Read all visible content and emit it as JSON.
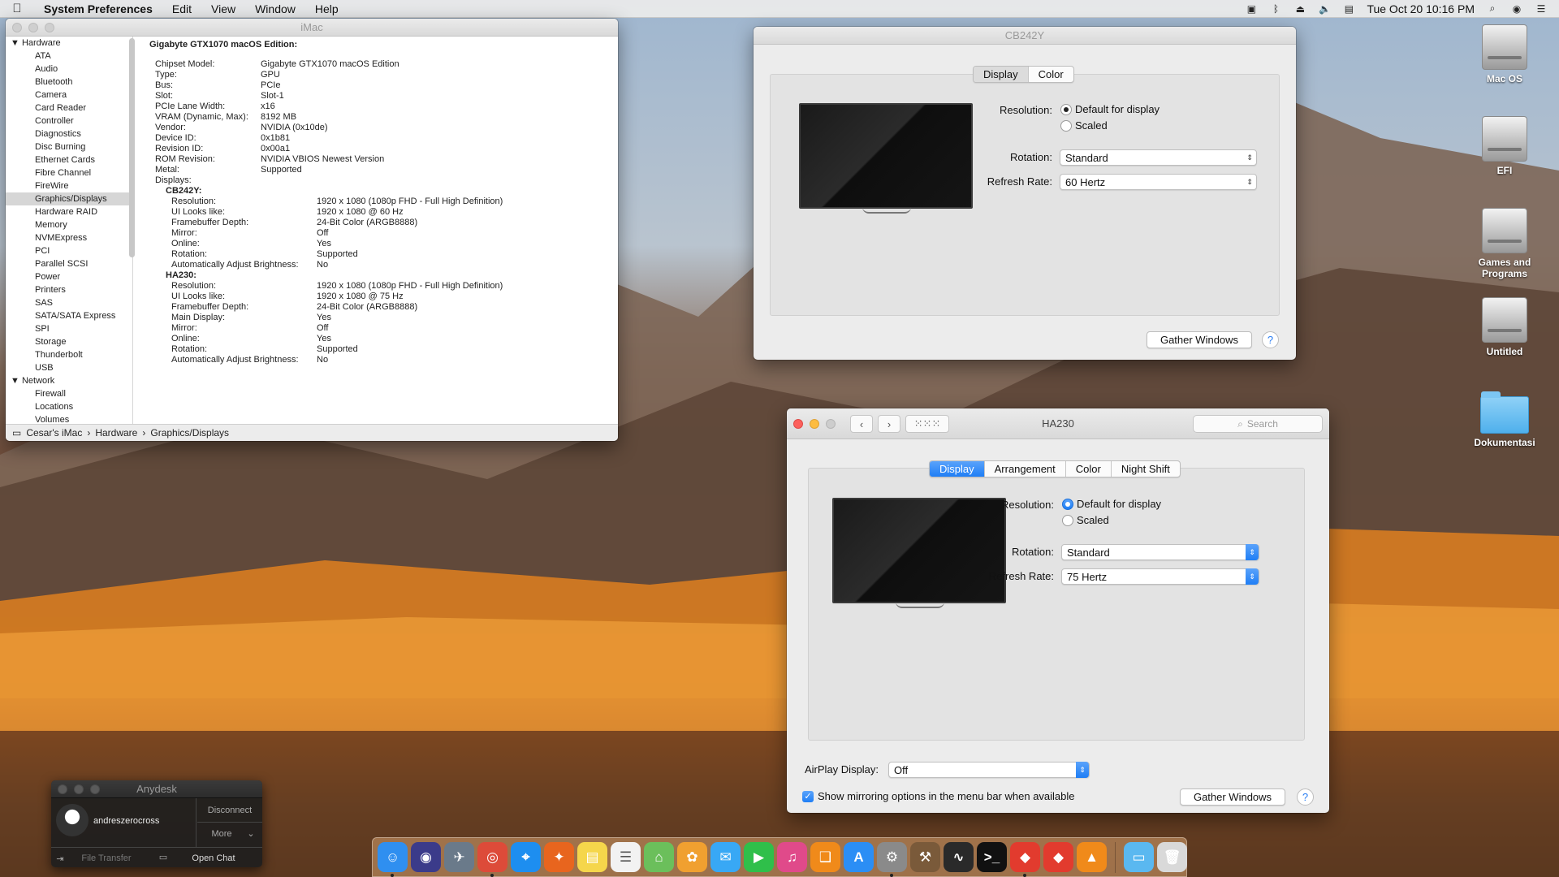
{
  "menubar": {
    "apple_icon": "apple-icon",
    "app_name": "System Preferences",
    "menus": [
      "Edit",
      "View",
      "Window",
      "Help"
    ],
    "status_icons": [
      "activity-icon",
      "bluetooth-icon",
      "airplay-icon",
      "volume-icon",
      "us-flag-icon"
    ],
    "datetime": "Tue Oct 20  10:16 PM",
    "right_icons": [
      "search-icon",
      "siri-icon",
      "list-icon"
    ]
  },
  "sysinfo": {
    "title": "iMac",
    "sidebar": {
      "hardware_label": "Hardware",
      "hardware_items": [
        "ATA",
        "Audio",
        "Bluetooth",
        "Camera",
        "Card Reader",
        "Controller",
        "Diagnostics",
        "Disc Burning",
        "Ethernet Cards",
        "Fibre Channel",
        "FireWire",
        "Graphics/Displays",
        "Hardware RAID",
        "Memory",
        "NVMExpress",
        "PCI",
        "Parallel SCSI",
        "Power",
        "Printers",
        "SAS",
        "SATA/SATA Express",
        "SPI",
        "Storage",
        "Thunderbolt",
        "USB"
      ],
      "selected": "Graphics/Displays",
      "network_label": "Network",
      "network_items": [
        "Firewall",
        "Locations",
        "Volumes"
      ]
    },
    "heading": "Gigabyte GTX1070 macOS Edition:",
    "properties": [
      {
        "k": "Chipset Model:",
        "v": "Gigabyte GTX1070 macOS Edition"
      },
      {
        "k": "Type:",
        "v": "GPU"
      },
      {
        "k": "Bus:",
        "v": "PCIe"
      },
      {
        "k": "Slot:",
        "v": "Slot-1"
      },
      {
        "k": "PCIe Lane Width:",
        "v": "x16"
      },
      {
        "k": "VRAM (Dynamic, Max):",
        "v": "8192 MB"
      },
      {
        "k": "Vendor:",
        "v": "NVIDIA (0x10de)"
      },
      {
        "k": "Device ID:",
        "v": "0x1b81"
      },
      {
        "k": "Revision ID:",
        "v": "0x00a1"
      },
      {
        "k": "ROM Revision:",
        "v": "NVIDIA VBIOS Newest Version"
      },
      {
        "k": "Metal:",
        "v": "Supported"
      },
      {
        "k": "Displays:",
        "v": ""
      }
    ],
    "displays": [
      {
        "name": "CB242Y:",
        "props": [
          {
            "k": "Resolution:",
            "v": "1920 x 1080 (1080p FHD - Full High Definition)"
          },
          {
            "k": "UI Looks like:",
            "v": "1920 x 1080 @ 60 Hz"
          },
          {
            "k": "Framebuffer Depth:",
            "v": "24-Bit Color (ARGB8888)"
          },
          {
            "k": "Mirror:",
            "v": "Off"
          },
          {
            "k": "Online:",
            "v": "Yes"
          },
          {
            "k": "Rotation:",
            "v": "Supported"
          },
          {
            "k": "Automatically Adjust Brightness:",
            "v": "No"
          }
        ]
      },
      {
        "name": "HA230:",
        "props": [
          {
            "k": "Resolution:",
            "v": "1920 x 1080 (1080p FHD - Full High Definition)"
          },
          {
            "k": "UI Looks like:",
            "v": "1920 x 1080 @ 75 Hz"
          },
          {
            "k": "Framebuffer Depth:",
            "v": "24-Bit Color (ARGB8888)"
          },
          {
            "k": "Main Display:",
            "v": "Yes"
          },
          {
            "k": "Mirror:",
            "v": "Off"
          },
          {
            "k": "Online:",
            "v": "Yes"
          },
          {
            "k": "Rotation:",
            "v": "Supported"
          },
          {
            "k": "Automatically Adjust Brightness:",
            "v": "No"
          }
        ]
      }
    ],
    "path": [
      "Cesar's iMac",
      "Hardware",
      "Graphics/Displays"
    ]
  },
  "cb242y": {
    "title": "CB242Y",
    "tabs": [
      "Display",
      "Color"
    ],
    "resolution_label": "Resolution:",
    "res_default": "Default for display",
    "res_scaled": "Scaled",
    "rotation_label": "Rotation:",
    "rotation_value": "Standard",
    "refresh_label": "Refresh Rate:",
    "refresh_value": "60 Hertz",
    "gather_label": "Gather Windows",
    "help": "?"
  },
  "ha230": {
    "title": "HA230",
    "search_placeholder": "Search",
    "tabs": [
      "Display",
      "Arrangement",
      "Color",
      "Night Shift"
    ],
    "resolution_label": "Resolution:",
    "res_default": "Default for display",
    "res_scaled": "Scaled",
    "rotation_label": "Rotation:",
    "rotation_value": "Standard",
    "refresh_label": "Refresh Rate:",
    "refresh_value": "75 Hertz",
    "airplay_label": "AirPlay Display:",
    "airplay_value": "Off",
    "mirroring_label": "Show mirroring options in the menu bar when available",
    "gather_label": "Gather Windows",
    "help": "?"
  },
  "desktop_icons": [
    {
      "label": "Mac OS",
      "type": "drive"
    },
    {
      "label": "EFI",
      "type": "drive"
    },
    {
      "label": "Games and Programs",
      "type": "drive"
    },
    {
      "label": "Untitled",
      "type": "drive"
    },
    {
      "label": "Dokumentasi",
      "type": "folder"
    }
  ],
  "anydesk": {
    "title": "Anydesk",
    "user": "andreszerocross",
    "disconnect": "Disconnect",
    "more": "More",
    "file_transfer": "File Transfer",
    "open_chat": "Open Chat"
  },
  "dock": {
    "apps": [
      {
        "name": "finder-icon",
        "color": "#2f8ff0",
        "glyph": "☺"
      },
      {
        "name": "siri-icon",
        "color": "#3b3b8a",
        "glyph": "◉"
      },
      {
        "name": "launchpad-icon",
        "color": "#6a7a8a",
        "glyph": "✈"
      },
      {
        "name": "chrome-icon",
        "color": "#dd4b39",
        "glyph": "◎"
      },
      {
        "name": "safari-icon",
        "color": "#1d8ef0",
        "glyph": "⌖"
      },
      {
        "name": "firefox-icon",
        "color": "#e8651e",
        "glyph": "✦"
      },
      {
        "name": "notes-icon",
        "color": "#f5d64b",
        "glyph": "▤"
      },
      {
        "name": "reminders-icon",
        "color": "#f2f2f2",
        "glyph": "☰"
      },
      {
        "name": "maps-icon",
        "color": "#6bbf5b",
        "glyph": "⌂"
      },
      {
        "name": "photos-icon",
        "color": "#f0a030",
        "glyph": "✿"
      },
      {
        "name": "messages-icon",
        "color": "#38a8f5",
        "glyph": "✉"
      },
      {
        "name": "facetime-icon",
        "color": "#2fbf4a",
        "glyph": "▶"
      },
      {
        "name": "itunes-icon",
        "color": "#e04a8a",
        "glyph": "♫"
      },
      {
        "name": "ibooks-icon",
        "color": "#f08a1a",
        "glyph": "❑"
      },
      {
        "name": "app-store-icon",
        "color": "#2b8ef5",
        "glyph": "A"
      },
      {
        "name": "system-preferences-icon",
        "color": "#8a8a8a",
        "glyph": "⚙"
      },
      {
        "name": "utility-icon",
        "color": "#7a5a3a",
        "glyph": "⚒"
      },
      {
        "name": "activity-monitor-icon",
        "color": "#2a2a2a",
        "glyph": "∿"
      },
      {
        "name": "terminal-icon",
        "color": "#111111",
        "glyph": ">_"
      },
      {
        "name": "anydesk-icon",
        "color": "#e23b2e",
        "glyph": "◆"
      },
      {
        "name": "anydesk2-icon",
        "color": "#e23b2e",
        "glyph": "◆"
      },
      {
        "name": "vlc-icon",
        "color": "#f08a1a",
        "glyph": "▲"
      }
    ],
    "trailing": [
      {
        "name": "downloads-folder-icon",
        "color": "#5ab8f0",
        "glyph": "▭"
      },
      {
        "name": "trash-icon",
        "color": "#d9d9d9",
        "glyph": "🗑"
      }
    ]
  }
}
